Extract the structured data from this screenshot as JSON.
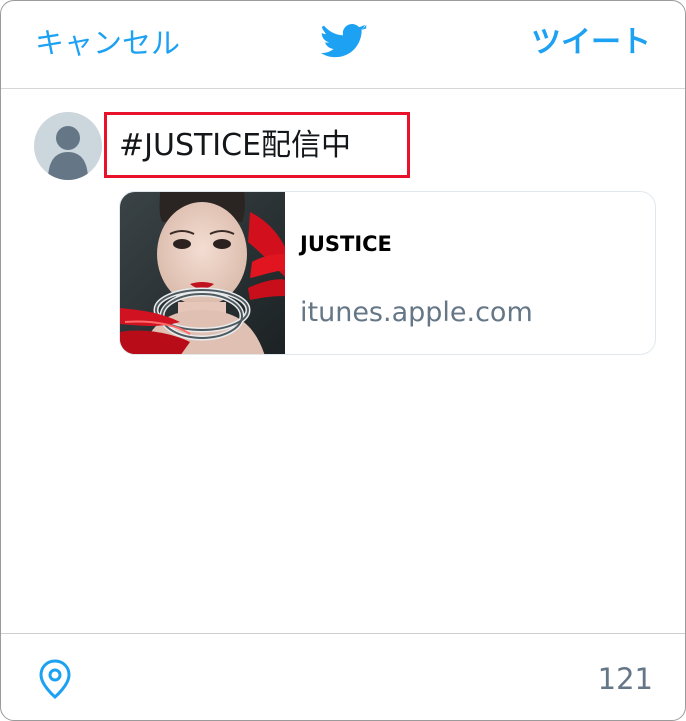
{
  "header": {
    "cancel_label": "キャンセル",
    "logo_icon": "twitter-bird-icon",
    "tweet_label": "ツイート"
  },
  "compose": {
    "avatar_icon": "default-avatar-icon",
    "text": "#JUSTICE配信中",
    "highlight_color": "#e8132b"
  },
  "card": {
    "thumbnail": "album-cover-image",
    "title": "JUSTICE",
    "domain": "itunes.apple.com"
  },
  "footer": {
    "location_icon": "location-pin-icon",
    "char_count": "121"
  },
  "colors": {
    "accent": "#1da1f2",
    "secondary_text": "#657786",
    "text": "#14171a"
  }
}
